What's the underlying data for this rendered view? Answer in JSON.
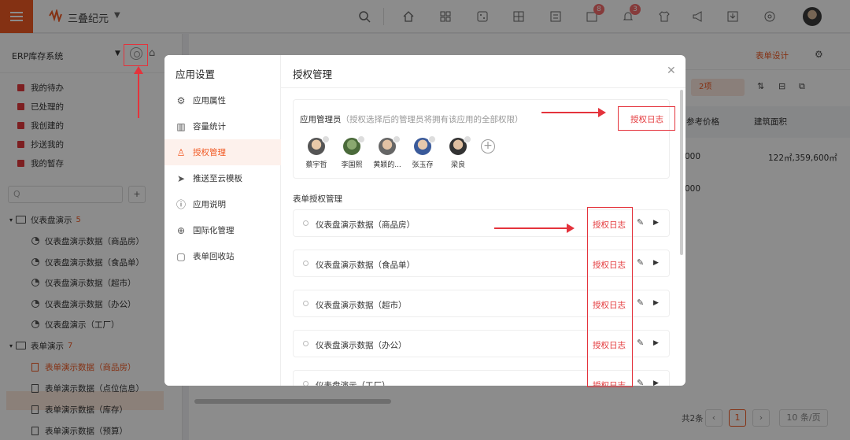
{
  "app": {
    "brand": "三叠纪元",
    "badges": {
      "apps": "8",
      "notice": "3"
    }
  },
  "sidebar": {
    "system": "ERP库存系统",
    "quick": [
      {
        "label": "我的待办"
      },
      {
        "label": "已处理的"
      },
      {
        "label": "我创建的"
      },
      {
        "label": "抄送我的"
      },
      {
        "label": "我的暂存"
      }
    ],
    "search_placeholder": "Q",
    "groups": [
      {
        "label": "仪表盘演示",
        "count": "5",
        "items": [
          "仪表盘演示数据（商品房）",
          "仪表盘演示数据（食品单）",
          "仪表盘演示数据（超市）",
          "仪表盘演示数据（办公）",
          "仪表盘演示（工厂）"
        ]
      },
      {
        "label": "表单演示",
        "count": "7",
        "items": [
          "表单演示数据（商品房）",
          "表单演示数据（点位信息）",
          "表单演示数据（库存）",
          "表单演示数据（预算）"
        ]
      }
    ]
  },
  "main": {
    "design": "表单设计",
    "filter": "2项",
    "columns": [
      "参考价格",
      "建筑面积"
    ],
    "rows": [
      [
        "000",
        "122㎡,359,600㎡"
      ],
      [
        "000",
        ""
      ]
    ],
    "total": "共2条",
    "page": "1",
    "pagesize": "10 条/页"
  },
  "modal": {
    "nav_title": "应用设置",
    "nav": [
      "应用属性",
      "容量统计",
      "授权管理",
      "推送至云模板",
      "应用说明",
      "国际化管理",
      "表单回收站"
    ],
    "title": "授权管理",
    "admin_label": "应用管理员",
    "admin_hint": "（授权选择后的管理员将拥有该应用的全部权限）",
    "log": "授权日志",
    "admins": [
      "蔡宇哲",
      "李国熙",
      "黄颖的...",
      "张玉存",
      "梁良"
    ],
    "section": "表单授权管理",
    "forms": [
      "仪表盘演示数据（商品房）",
      "仪表盘演示数据（食品单）",
      "仪表盘演示数据（超市）",
      "仪表盘演示数据（办公）",
      "仪表盘演示（工厂）"
    ]
  }
}
